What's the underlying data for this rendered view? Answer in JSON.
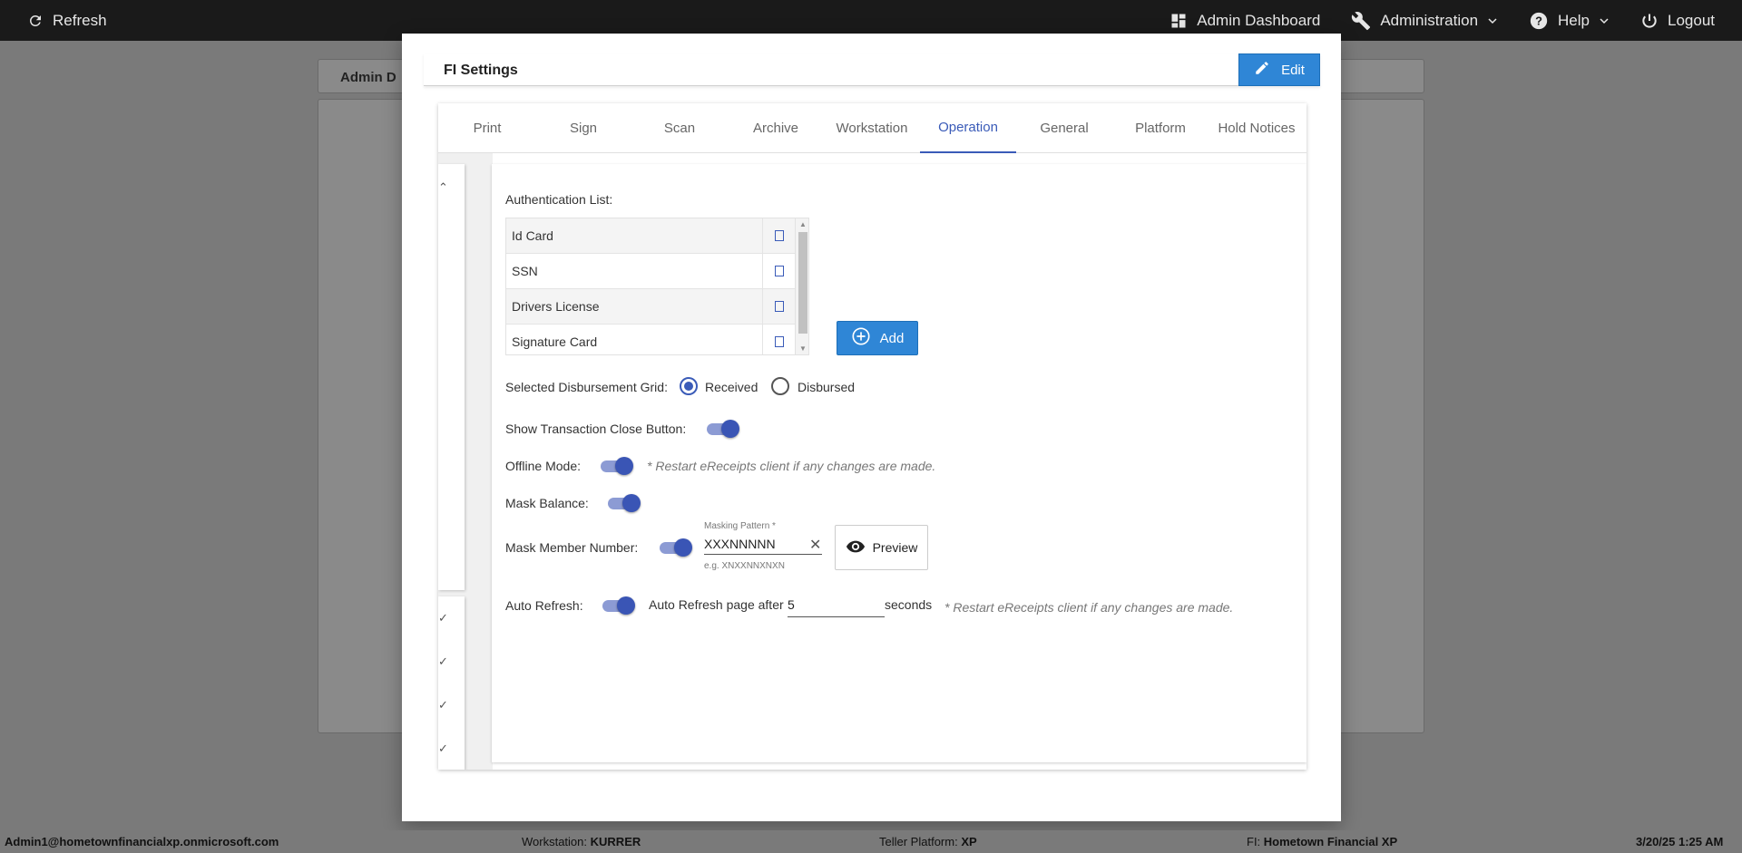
{
  "topbar": {
    "refresh_label": "Refresh",
    "admin_dashboard_label": "Admin Dashboard",
    "administration_label": "Administration",
    "help_label": "Help",
    "logout_label": "Logout"
  },
  "background": {
    "panel_title": "Admin D"
  },
  "modal": {
    "title": "FI Settings",
    "edit_label": "Edit",
    "tabs": [
      {
        "label": "Print"
      },
      {
        "label": "Sign"
      },
      {
        "label": "Scan"
      },
      {
        "label": "Archive"
      },
      {
        "label": "Workstation"
      },
      {
        "label": "Operation"
      },
      {
        "label": "General"
      },
      {
        "label": "Platform"
      },
      {
        "label": "Hold Notices"
      }
    ],
    "active_tab": "Operation"
  },
  "operation": {
    "auth_list_label": "Authentication List:",
    "auth_items": [
      {
        "name": "Id Card",
        "checked": false
      },
      {
        "name": "SSN",
        "checked": false
      },
      {
        "name": "Drivers License",
        "checked": false
      },
      {
        "name": "Signature Card",
        "checked": false
      }
    ],
    "add_label": "Add",
    "disbursement_label": "Selected Disbursement Grid:",
    "received_label": "Received",
    "disbursed_label": "Disbursed",
    "disbursement_selected": "Received",
    "show_close_label": "Show Transaction Close Button:",
    "offline_label": "Offline Mode:",
    "offline_note": "* Restart eReceipts client if any changes are made.",
    "mask_balance_label": "Mask Balance:",
    "mask_member_label": "Mask Member Number:",
    "masking_pattern_label": "Masking Pattern *",
    "masking_pattern_value": "XXXNNNNN",
    "masking_pattern_hint": "e.g. XNXXNNXNXN",
    "clear_glyph": "✕",
    "preview_label": "Preview",
    "auto_refresh_label": "Auto Refresh:",
    "auto_refresh_text": "Auto Refresh page after",
    "auto_refresh_value": "5",
    "seconds_label": "seconds",
    "auto_refresh_note": "* Restart eReceipts client if any changes are made.",
    "toggles": {
      "show_close": true,
      "offline": true,
      "mask_balance": true,
      "mask_member": true,
      "auto_refresh": true
    }
  },
  "statusbar": {
    "user": "Admin1@hometownfinancialxp.onmicrosoft.com",
    "workstation_label": "Workstation:",
    "workstation_value": "KURRER",
    "teller_label": "Teller Platform:",
    "teller_value": "XP",
    "fi_label": "FI:",
    "fi_value": "Hometown Financial XP",
    "datetime": "3/20/25 1:25 AM"
  },
  "colors": {
    "accent": "#3a5bb8",
    "button_blue": "#2f86d6",
    "topbar": "#1a1a1a",
    "overlay": "#7a7a7a"
  }
}
